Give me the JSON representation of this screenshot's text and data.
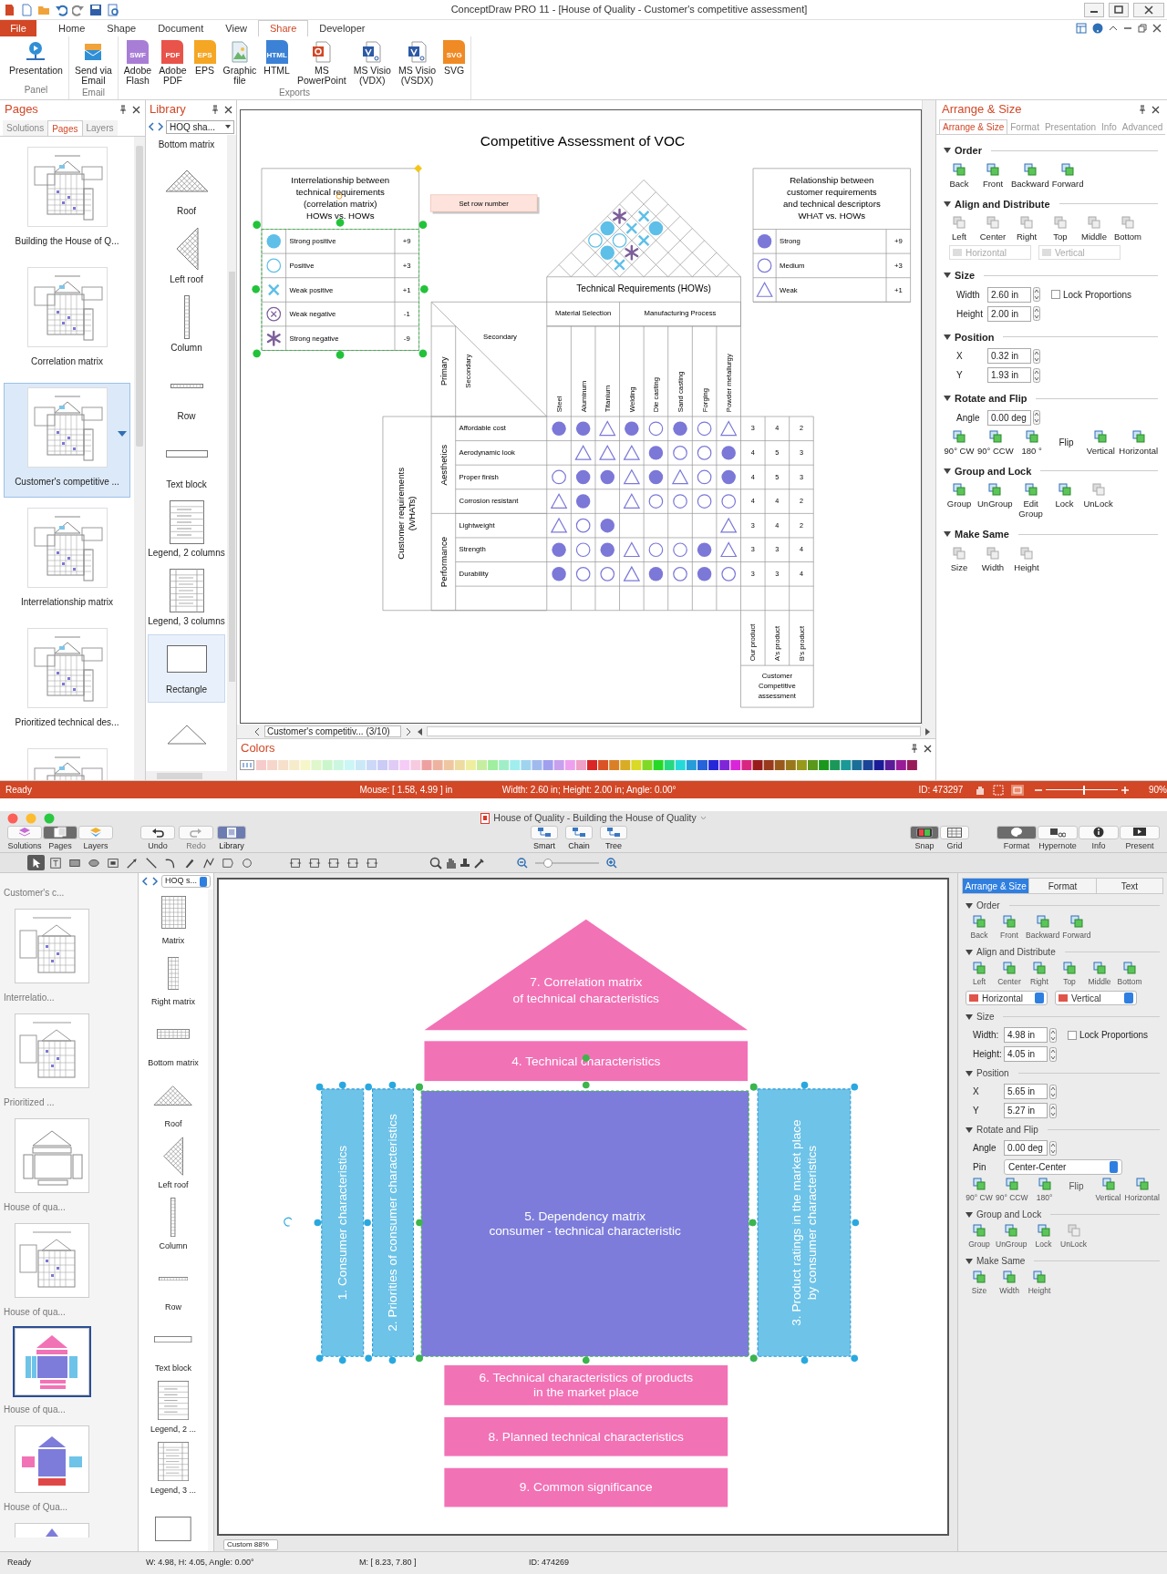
{
  "top_window": {
    "title": "ConceptDraw PRO 11 - [House of Quality - Customer's competitive assessment]",
    "file_tab": "File",
    "ribbon_tabs": [
      {
        "label": "Home",
        "selected": false
      },
      {
        "label": "Shape",
        "selected": false
      },
      {
        "label": "Document",
        "selected": false
      },
      {
        "label": "View",
        "selected": false
      },
      {
        "label": "Share",
        "selected": true
      },
      {
        "label": "Developer",
        "selected": false
      }
    ],
    "ribbon_groups": [
      {
        "label": "Panel",
        "buttons": [
          {
            "label": "Presentation",
            "kind": "presentation"
          }
        ]
      },
      {
        "label": "Email",
        "buttons": [
          {
            "label": "Send via\nEmail",
            "kind": "email"
          }
        ]
      },
      {
        "label": "Exports",
        "buttons": [
          {
            "label": "Adobe\nFlash",
            "kind": "file",
            "badge": "SWF",
            "color": "#a87dd6"
          },
          {
            "label": "Adobe\nPDF",
            "kind": "file",
            "badge": "PDF",
            "color": "#e8534a"
          },
          {
            "label": "EPS",
            "kind": "file",
            "badge": "EPS",
            "color": "#f5a623"
          },
          {
            "label": "Graphic\nfile",
            "kind": "image"
          },
          {
            "label": "HTML",
            "kind": "file",
            "badge": "HTML",
            "color": "#3b82d6"
          },
          {
            "label": "MS\nPowerPoint",
            "kind": "slides"
          },
          {
            "label": "MS Visio\n(VDX)",
            "kind": "diagram"
          },
          {
            "label": "MS Visio\n(VSDX)",
            "kind": "diagram"
          },
          {
            "label": "SVG",
            "kind": "file",
            "badge": "SVG",
            "color": "#f08a24"
          }
        ]
      }
    ],
    "pages_panel": {
      "title": "Pages",
      "tabs": [
        {
          "label": "Solutions",
          "selected": false
        },
        {
          "label": "Pages",
          "selected": true
        },
        {
          "label": "Layers",
          "selected": false
        }
      ],
      "pages": [
        {
          "label": "Building the House of Q...",
          "selected": false
        },
        {
          "label": "Correlation matrix",
          "selected": false
        },
        {
          "label": "Customer's competitive ...",
          "selected": true
        },
        {
          "label": "Interrelationship matrix",
          "selected": false
        },
        {
          "label": "Prioritized technical des...",
          "selected": false
        },
        {
          "selected": false
        }
      ]
    },
    "library_panel": {
      "title": "Library",
      "combo": "HOQ sha...",
      "items": [
        {
          "label": "Bottom matrix",
          "kind": "hidden",
          "selected": false
        },
        {
          "label": "Roof",
          "kind": "roof",
          "selected": false
        },
        {
          "label": "Left roof",
          "kind": "left_roof",
          "selected": false
        },
        {
          "label": "Column",
          "kind": "column",
          "selected": false
        },
        {
          "label": "Row",
          "kind": "row",
          "selected": false
        },
        {
          "label": "Text block",
          "kind": "text_block",
          "selected": false
        },
        {
          "label": "Legend, 2 columns",
          "kind": "legend",
          "selected": false
        },
        {
          "label": "Legend, 3 columns",
          "kind": "legend3",
          "selected": false
        },
        {
          "label": "Rectangle",
          "kind": "rectangle",
          "selected": true
        },
        {
          "kind": "triangle",
          "selected": false
        }
      ]
    },
    "drawing": {
      "title": "Competitive Assessment of VOC",
      "correlation_legend": {
        "heading": "Interrelationship between\ntechnical requirements\n(correlation matrix)\nHOWs vs. HOWs",
        "entries": [
          {
            "kind": "strong_positive",
            "label": "Strong positive",
            "value": "+9"
          },
          {
            "kind": "positive",
            "label": "Positive",
            "value": "+3"
          },
          {
            "kind": "weak_positive",
            "label": "Weak positive",
            "value": "+1"
          },
          {
            "kind": "weak_negative",
            "label": "Weak negative",
            "value": "-1"
          },
          {
            "kind": "strong_negative",
            "label": "Strong negative",
            "value": "-9"
          }
        ]
      },
      "set_row_number": "Set row number",
      "relationship_legend": {
        "heading": "Relationship between\ncustomer requirements\nand technical descriptors\nWHAT vs. HOWs",
        "entries": [
          {
            "kind": "strong",
            "label": "Strong",
            "value": "+9"
          },
          {
            "kind": "medium",
            "label": "Medium",
            "value": "+3"
          },
          {
            "kind": "weak",
            "label": "Weak",
            "value": "+1"
          }
        ]
      },
      "roof": [
        [
          {
            "kind": "empty"
          },
          {
            "kind": "empty"
          },
          {
            "kind": "weak_positive"
          },
          {
            "kind": "empty"
          },
          {
            "kind": "empty"
          },
          {
            "kind": "empty"
          },
          {
            "kind": "empty"
          }
        ],
        [
          {
            "kind": "empty"
          },
          {
            "kind": "strong_positive"
          },
          {
            "kind": "strong_negative"
          },
          {
            "kind": "empty"
          },
          {
            "kind": "empty"
          },
          {
            "kind": "empty"
          }
        ],
        [
          {
            "kind": "positive"
          },
          {
            "kind": "positive"
          },
          {
            "kind": "weak_positive"
          },
          {
            "kind": "empty"
          },
          {
            "kind": "empty"
          }
        ],
        [
          {
            "kind": "strong_positive"
          },
          {
            "kind": "weak_positive"
          },
          {
            "kind": "strong_positive"
          },
          {
            "kind": "empty"
          }
        ],
        [
          {
            "kind": "strong_negative"
          },
          {
            "kind": "weak_positive"
          },
          {
            "kind": "empty"
          }
        ],
        [
          {
            "kind": "empty"
          },
          {
            "kind": "empty"
          }
        ],
        [
          {
            "kind": "empty"
          }
        ]
      ],
      "technical_requirements": "Technical Requirements (HOWs)",
      "column_groups": [
        {
          "label": "Material Selection",
          "columns": [
            "Steel",
            "Aluminum",
            "Titanium"
          ]
        },
        {
          "label": "Manufacturing Process",
          "columns": [
            "Welding",
            "Die casting",
            "Sand casting",
            "Forging",
            "Powder metallurgy"
          ]
        }
      ],
      "corner": {
        "primary": "Primary",
        "secondary_vertical": "Secondary",
        "secondary": "Secondary"
      },
      "customer_requirements": "Customer requirements\n(WHATs)",
      "row_groups": [
        {
          "label": "Aesthetics",
          "rows": [
            {
              "label": "Affordable cost",
              "cells": [
                {
                  "kind": "strong"
                },
                {
                  "kind": "strong"
                },
                {
                  "kind": "weak"
                },
                {
                  "kind": "strong"
                },
                {
                  "kind": "medium"
                },
                {
                  "kind": "strong"
                },
                {
                  "kind": "medium"
                },
                {
                  "kind": "weak"
                }
              ],
              "ratings": [
                "3",
                "4",
                "2"
              ]
            },
            {
              "label": "Aerodynamic look",
              "cells": [
                {
                  "kind": "empty"
                },
                {
                  "kind": "weak"
                },
                {
                  "kind": "weak"
                },
                {
                  "kind": "weak"
                },
                {
                  "kind": "strong"
                },
                {
                  "kind": "medium"
                },
                {
                  "kind": "medium"
                },
                {
                  "kind": "strong"
                }
              ],
              "ratings": [
                "4",
                "5",
                "3"
              ]
            },
            {
              "label": "Proper finish",
              "cells": [
                {
                  "kind": "medium"
                },
                {
                  "kind": "strong"
                },
                {
                  "kind": "strong"
                },
                {
                  "kind": "weak"
                },
                {
                  "kind": "strong"
                },
                {
                  "kind": "weak"
                },
                {
                  "kind": "medium"
                },
                {
                  "kind": "strong"
                }
              ],
              "ratings": [
                "4",
                "5",
                "3"
              ]
            },
            {
              "label": "Corrosion resistant",
              "cells": [
                {
                  "kind": "weak"
                },
                {
                  "kind": "strong"
                },
                {
                  "kind": "empty"
                },
                {
                  "kind": "weak"
                },
                {
                  "kind": "medium"
                },
                {
                  "kind": "medium"
                },
                {
                  "kind": "medium"
                },
                {
                  "kind": "medium"
                }
              ],
              "ratings": [
                "4",
                "4",
                "2"
              ]
            }
          ]
        },
        {
          "label": "Performance",
          "rows": [
            {
              "label": "Lightweight",
              "cells": [
                {
                  "kind": "weak"
                },
                {
                  "kind": "medium"
                },
                {
                  "kind": "strong"
                },
                {
                  "kind": "empty"
                },
                {
                  "kind": "empty"
                },
                {
                  "kind": "empty"
                },
                {
                  "kind": "empty"
                },
                {
                  "kind": "weak"
                }
              ],
              "ratings": [
                "3",
                "4",
                "2"
              ]
            },
            {
              "label": "Strength",
              "cells": [
                {
                  "kind": "strong"
                },
                {
                  "kind": "medium"
                },
                {
                  "kind": "strong"
                },
                {
                  "kind": "weak"
                },
                {
                  "kind": "medium"
                },
                {
                  "kind": "medium"
                },
                {
                  "kind": "strong"
                },
                {
                  "kind": "weak"
                }
              ],
              "ratings": [
                "3",
                "3",
                "4"
              ]
            },
            {
              "label": "Durability",
              "cells": [
                {
                  "kind": "strong"
                },
                {
                  "kind": "medium"
                },
                {
                  "kind": "medium"
                },
                {
                  "kind": "weak"
                },
                {
                  "kind": "strong"
                },
                {
                  "kind": "medium"
                },
                {
                  "kind": "strong"
                },
                {
                  "kind": "medium"
                }
              ],
              "ratings": [
                "3",
                "3",
                "4"
              ]
            },
            {
              "cells": [
                {
                  "kind": "empty"
                },
                {
                  "kind": "empty"
                },
                {
                  "kind": "empty"
                },
                {
                  "kind": "empty"
                },
                {
                  "kind": "empty"
                },
                {
                  "kind": "empty"
                },
                {
                  "kind": "empty"
                },
                {
                  "kind": "empty"
                }
              ]
            }
          ]
        }
      ],
      "competitors": [
        "Our product",
        "A's product",
        "B's product"
      ],
      "assessment": "Customer\nCompetitive\nassessment"
    },
    "page_selector": "Customer's competitiv... (3/10)",
    "colors_panel": {
      "title": "Colors"
    },
    "arrange_panel": {
      "title": "Arrange & Size",
      "tabs": [
        {
          "label": "Arrange & Size",
          "selected": true
        },
        {
          "label": "Format",
          "selected": false
        },
        {
          "label": "Presentation",
          "selected": false
        },
        {
          "label": "Info",
          "selected": false
        },
        {
          "label": "Advanced",
          "selected": false
        }
      ],
      "sections": [
        {
          "title": "Order",
          "rows": [
            {
              "kind": "buttons",
              "buttons": [
                {
                  "label": "Back",
                  "disabled": false
                },
                {
                  "label": "Front",
                  "disabled": false
                },
                {
                  "label": "Backward",
                  "disabled": false
                },
                {
                  "label": "Forward",
                  "disabled": false
                }
              ]
            }
          ]
        },
        {
          "title": "Align and Distribute",
          "rows": [
            {
              "kind": "buttons",
              "buttons": [
                {
                  "label": "Left",
                  "disabled": true
                },
                {
                  "label": "Center",
                  "disabled": true
                },
                {
                  "label": "Right",
                  "disabled": true
                },
                {
                  "label": "Top",
                  "disabled": true
                },
                {
                  "label": "Middle",
                  "disabled": true
                },
                {
                  "label": "Bottom",
                  "disabled": true
                }
              ]
            },
            {
              "kind": "combos",
              "combos": [
                {
                  "value": "Horizontal",
                  "disabled": true
                },
                {
                  "value": "Vertical",
                  "disabled": true
                }
              ]
            }
          ]
        },
        {
          "title": "Size",
          "rows": [
            {
              "kind": "field",
              "label": "Width",
              "value": "2.60 in",
              "checkbox": {
                "label": "Lock Proportions",
                "checked": false
              }
            },
            {
              "kind": "field",
              "label": "Height",
              "value": "2.00 in"
            }
          ]
        },
        {
          "title": "Position",
          "rows": [
            {
              "kind": "field",
              "label": "X",
              "value": "0.32 in"
            },
            {
              "kind": "field",
              "label": "Y",
              "value": "1.93 in"
            }
          ]
        },
        {
          "title": "Rotate and Flip",
          "rows": [
            {
              "kind": "field",
              "label": "Angle",
              "value": "0.00 deg"
            },
            {
              "kind": "buttons",
              "buttons": [
                {
                  "kind": "button",
                  "label": "90° CW",
                  "disabled": false
                },
                {
                  "kind": "button",
                  "label": "90° CCW",
                  "disabled": false
                },
                {
                  "kind": "button",
                  "label": "180 °",
                  "disabled": false
                },
                {
                  "kind": "label",
                  "label": "Flip"
                },
                {
                  "kind": "button",
                  "label": "Vertical",
                  "disabled": false
                },
                {
                  "kind": "button",
                  "label": "Horizontal",
                  "disabled": false
                }
              ]
            }
          ]
        },
        {
          "title": "Group and Lock",
          "rows": [
            {
              "kind": "buttons",
              "buttons": [
                {
                  "label": "Group",
                  "disabled": false
                },
                {
                  "label": "UnGroup",
                  "disabled": false
                },
                {
                  "label": "Edit\nGroup",
                  "disabled": false
                },
                {
                  "label": "Lock",
                  "disabled": false
                },
                {
                  "label": "UnLock",
                  "disabled": true
                }
              ]
            }
          ]
        },
        {
          "title": "Make Same",
          "rows": [
            {
              "kind": "buttons",
              "buttons": [
                {
                  "label": "Size",
                  "disabled": true
                },
                {
                  "label": "Width",
                  "disabled": true
                },
                {
                  "label": "Height",
                  "disabled": true
                }
              ]
            }
          ]
        }
      ]
    },
    "status_bar": {
      "state": "Ready",
      "mouse": "Mouse: [ 1.58, 4.99 ] in",
      "selection": "Width: 2.60 in; Height: 2.00 in; Angle: 0.00°",
      "id": "ID: 473297",
      "zoom": "90%",
      "zoom_slider": {
        "level": 0.52
      }
    }
  },
  "bottom_window": {
    "title": "House of Quality - Building the House of Quality",
    "view_buttons": [
      {
        "label": "Solutions",
        "kind": "solutions",
        "selected": false
      },
      {
        "label": "Pages",
        "kind": "pages",
        "selected": true
      },
      {
        "label": "Layers",
        "kind": "layers",
        "selected": false
      }
    ],
    "edit_buttons": [
      {
        "label": "Undo",
        "kind": "undo",
        "disabled": false
      },
      {
        "label": "Redo",
        "kind": "redo",
        "disabled": true
      }
    ],
    "library_button": {
      "label": "Library",
      "selected": true
    },
    "structure_buttons": [
      {
        "label": "Smart"
      },
      {
        "label": "Chain"
      },
      {
        "label": "Tree"
      }
    ],
    "snap_buttons": [
      {
        "label": "Snap",
        "kind": "snap",
        "selected": true
      },
      {
        "label": "Grid",
        "kind": "grid",
        "selected": false
      }
    ],
    "panel_buttons": [
      {
        "label": "Format",
        "kind": "format",
        "selected": true
      },
      {
        "label": "Hypernote",
        "kind": "hypernote",
        "selected": false
      },
      {
        "label": "Info",
        "kind": "info",
        "selected": false
      },
      {
        "label": "Present",
        "kind": "present",
        "selected": false
      }
    ],
    "tools": [
      {
        "selected": true
      },
      {
        "selected": false
      },
      {
        "selected": false
      },
      {
        "selected": false
      },
      {
        "selected": false
      },
      {
        "selected": false
      },
      {
        "selected": false
      },
      {
        "selected": false
      },
      {
        "selected": false
      },
      {
        "selected": false
      },
      {
        "selected": false
      },
      {
        "selected": false
      }
    ],
    "zoom_slider": {
      "level": 0.2
    },
    "pages": [
      {
        "label": "Customer's c...",
        "kind": "hidden",
        "selected": false
      },
      {
        "label": "Interrelatio...",
        "kind": "matrix",
        "selected": false
      },
      {
        "label": "Prioritized ...",
        "kind": "matrix",
        "selected": false
      },
      {
        "label": "House of qua...",
        "kind": "outline",
        "selected": false
      },
      {
        "label": "House of qua...",
        "kind": "matrix",
        "selected": false
      },
      {
        "label": "House of qua...",
        "kind": "house",
        "selected": true
      },
      {
        "label": "House of Qua...",
        "kind": "house_color",
        "selected": false
      },
      {
        "kind": "partial",
        "selected": false
      }
    ],
    "library_combo": "HOQ s...",
    "library_items": [
      {
        "label": "Matrix",
        "kind": "matrix"
      },
      {
        "label": "Right matrix",
        "kind": "right_matrix"
      },
      {
        "label": "Bottom matrix",
        "kind": "bottom_matrix"
      },
      {
        "label": "Roof",
        "kind": "roof"
      },
      {
        "label": "Left roof",
        "kind": "left_roof"
      },
      {
        "label": "Column",
        "kind": "column"
      },
      {
        "label": "Row",
        "kind": "row"
      },
      {
        "label": "Text block",
        "kind": "text_block"
      },
      {
        "label": "Legend, 2 ...",
        "kind": "legend"
      },
      {
        "label": "Legend, 3 ...",
        "kind": "legend3"
      },
      {
        "kind": "rectangle"
      }
    ],
    "diagram": [
      {
        "kind": "roof",
        "text": "7. Correlation matrix\nof technical characteristics",
        "color": "#f272b6"
      },
      {
        "kind": "top_bar",
        "text": "4. Technical characteristics",
        "color": "#f272b6"
      },
      {
        "kind": "side_column",
        "text": "1. Consumer characteristics",
        "color": "#6ec3e8"
      },
      {
        "kind": "side_column",
        "text": "2. Priorities of consumer characteristics",
        "color": "#6ec3e8"
      },
      {
        "kind": "matrix",
        "text": "5. Dependency matrix\nconsumer - technical characteristic",
        "color": "#7d7cdb"
      },
      {
        "kind": "side_column",
        "text": "3. Product ratings in the market place\nby consumer characteristics",
        "color": "#6ec3e8"
      },
      {
        "kind": "bottom_bar",
        "text": "6. Technical characteristics of products\nin the market place",
        "color": "#f272b6"
      },
      {
        "kind": "bottom_bar",
        "text": "8. Planned technical characteristics",
        "color": "#f272b6"
      },
      {
        "kind": "bottom_bar",
        "text": "9. Common significance",
        "color": "#f272b6"
      }
    ],
    "zoom_combo": "Custom 88%",
    "arrange_panel": {
      "tabs": [
        {
          "label": "Arrange & Size",
          "selected": true
        },
        {
          "label": "Format",
          "selected": false
        },
        {
          "label": "Text",
          "selected": false
        }
      ],
      "sections": [
        {
          "title": "Order",
          "rows": [
            {
              "kind": "buttons",
              "buttons": [
                {
                  "label": "Back",
                  "disabled": false
                },
                {
                  "label": "Front",
                  "disabled": false
                },
                {
                  "label": "Backward",
                  "disabled": false
                },
                {
                  "label": "Forward",
                  "disabled": false
                }
              ]
            }
          ]
        },
        {
          "title": "Align and Distribute",
          "rows": [
            {
              "kind": "buttons",
              "buttons": [
                {
                  "label": "Left",
                  "disabled": false
                },
                {
                  "label": "Center",
                  "disabled": false
                },
                {
                  "label": "Right",
                  "disabled": false
                },
                {
                  "label": "Top",
                  "disabled": false
                },
                {
                  "label": "Middle",
                  "disabled": false
                },
                {
                  "label": "Bottom",
                  "disabled": false
                }
              ]
            },
            {
              "kind": "combos",
              "combos": [
                {
                  "value": "Horizontal",
                  "disabled": false
                },
                {
                  "value": "Vertical",
                  "disabled": false
                }
              ]
            }
          ]
        },
        {
          "title": "Size",
          "rows": [
            {
              "kind": "field",
              "label": "Width:",
              "value": "4.98 in",
              "checkbox": {
                "label": "Lock Proportions",
                "checked": false
              }
            },
            {
              "kind": "field",
              "label": "Height:",
              "value": "4.05 in"
            }
          ]
        },
        {
          "title": "Position",
          "rows": [
            {
              "kind": "field",
              "label": "X",
              "value": "5.65 in"
            },
            {
              "kind": "field",
              "label": "Y",
              "value": "5.27 in"
            }
          ]
        },
        {
          "title": "Rotate and Flip",
          "rows": [
            {
              "kind": "field",
              "label": "Angle",
              "value": "0.00 deg"
            },
            {
              "kind": "combo_field",
              "label": "Pin",
              "value": "Center-Center"
            },
            {
              "kind": "buttons",
              "buttons": [
                {
                  "kind": "button",
                  "label": "90° CW",
                  "disabled": false
                },
                {
                  "kind": "button",
                  "label": "90° CCW",
                  "disabled": false
                },
                {
                  "kind": "button",
                  "label": "180°",
                  "disabled": false
                },
                {
                  "kind": "label",
                  "label": "Flip"
                },
                {
                  "kind": "button",
                  "label": "Vertical",
                  "disabled": false
                },
                {
                  "kind": "button",
                  "label": "Horizontal",
                  "disabled": false
                }
              ]
            }
          ]
        },
        {
          "title": "Group and Lock",
          "rows": [
            {
              "kind": "buttons",
              "buttons": [
                {
                  "label": "Group",
                  "disabled": false
                },
                {
                  "label": "UnGroup",
                  "disabled": false
                },
                {
                  "label": "Lock",
                  "disabled": false
                },
                {
                  "label": "UnLock",
                  "disabled": true
                }
              ]
            }
          ]
        },
        {
          "title": "Make Same",
          "rows": [
            {
              "kind": "buttons",
              "buttons": [
                {
                  "label": "Size",
                  "disabled": false
                },
                {
                  "label": "Width",
                  "disabled": false
                },
                {
                  "label": "Height",
                  "disabled": false
                }
              ]
            }
          ]
        }
      ]
    },
    "status_bar": {
      "state": "Ready",
      "selection": "W: 4.98, H: 4.05, Angle: 0.00°",
      "mouse": "M: [ 8.23, 7.80 ]",
      "id": "ID: 474269"
    }
  }
}
